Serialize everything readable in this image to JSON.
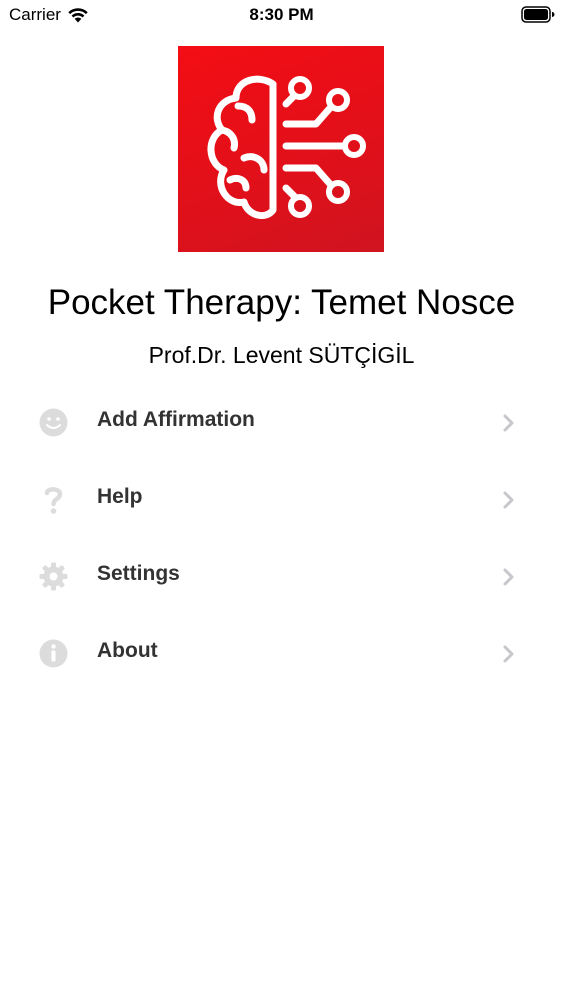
{
  "status_bar": {
    "carrier": "Carrier",
    "time": "8:30 PM",
    "wifi_icon": "wifi-icon",
    "battery_icon": "battery-icon"
  },
  "app": {
    "logo_icon": "brain-circuit-icon",
    "logo_color": "#e8101a",
    "title": "Pocket Therapy: Temet Nosce",
    "author": "Prof.Dr. Levent SÜTÇİGİL"
  },
  "menu": {
    "items": [
      {
        "label": "Add Affirmation",
        "icon": "smiley-icon"
      },
      {
        "label": "Help",
        "icon": "question-icon"
      },
      {
        "label": "Settings",
        "icon": "gear-icon"
      },
      {
        "label": "About",
        "icon": "info-icon"
      }
    ]
  }
}
